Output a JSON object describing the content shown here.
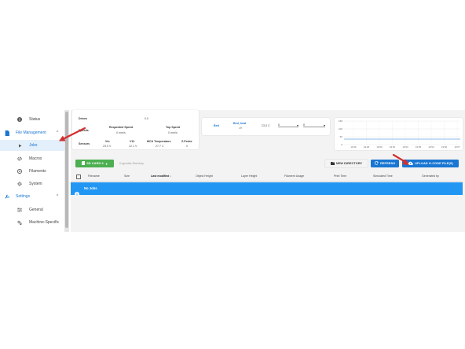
{
  "sidebar": {
    "items": [
      {
        "label": "Status",
        "icon": "info-icon",
        "type": "item"
      },
      {
        "label": "File Management",
        "icon": "file-icon",
        "type": "group",
        "chevron": "^"
      },
      {
        "label": "Jobs",
        "icon": "play-icon",
        "type": "item",
        "active": true
      },
      {
        "label": "Macros",
        "icon": "code-icon",
        "type": "item"
      },
      {
        "label": "Filaments",
        "icon": "disc-icon",
        "type": "item"
      },
      {
        "label": "System",
        "icon": "gear-icon",
        "type": "item"
      },
      {
        "label": "Settings",
        "icon": "wrench-icon",
        "type": "group",
        "chevron": "^"
      },
      {
        "label": "General",
        "icon": "sliders-icon",
        "type": "item"
      },
      {
        "label": "Machine-Specific",
        "icon": "gears-icon",
        "type": "item"
      }
    ]
  },
  "status_card": {
    "drives_label": "Drives",
    "drives_value": "0.0",
    "speeds_label": "Speeds",
    "requested_speed_label": "Requested Speed",
    "requested_speed_value": "0 mm/s",
    "top_speed_label": "Top Speed",
    "top_speed_value": "0 mm/s",
    "sensors_label": "Sensors",
    "vin_label": "Vin",
    "vin_value": "23.9 V",
    "v12_label": "V12",
    "v12_value": "12.1 V",
    "mcu_label": "MCU Temperature",
    "mcu_value": "27.7 C",
    "zprobe_label": "Z-Probe",
    "zprobe_value": "0"
  },
  "heater_card": {
    "bed_label": "Bed",
    "heater_name": "Bed_heat",
    "heater_sub": "off",
    "current_temp": "23.5 C",
    "active_value": "0",
    "standby_value": "0"
  },
  "temp_chart": {
    "y_ticks": [
      "150",
      "100",
      "50",
      "0"
    ],
    "x_ticks": [
      "19:46",
      "19:48",
      "19:50",
      "19:52",
      "19:54",
      "19:55",
      "19:54",
      "19:56",
      "19:57"
    ]
  },
  "toolbar": {
    "sd_card_label": "SD CARD 0",
    "path_text": "0:/gcodes Directory",
    "new_directory_label": "NEW DIRECTORY",
    "refresh_label": "REFRESH",
    "upload_label": "UPLOAD G-CODE FILE(S)"
  },
  "table": {
    "columns": [
      "Filename",
      "Size",
      "Last modified",
      "Object Height",
      "Layer Height",
      "Filament Usage",
      "Print Time",
      "Simulated Time",
      "Generated by"
    ],
    "empty_text": "No Jobs"
  },
  "colors": {
    "primary": "#1976d2",
    "green": "#4caf50",
    "annotation_arrow": "#d32f2f"
  }
}
